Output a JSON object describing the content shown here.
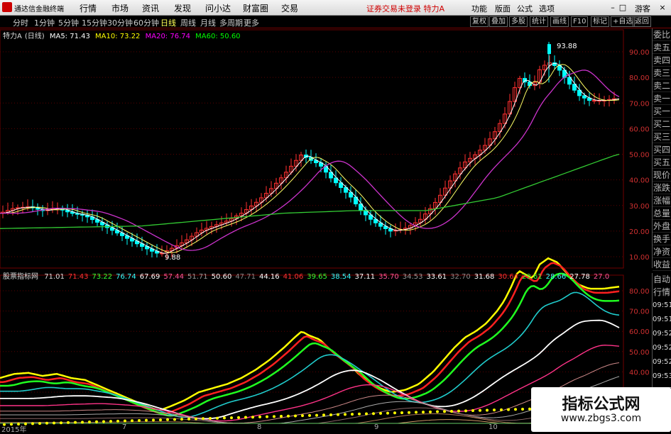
{
  "menubar": {
    "app_name": "通达信金融终端",
    "menus": [
      "行情",
      "市场",
      "资讯",
      "发现",
      "问小达",
      "财富圈",
      "交易"
    ],
    "notice": "证券交易未登录  特力A",
    "right_menus": [
      "功能",
      "版面",
      "公式",
      "选项"
    ],
    "user": "游客",
    "win_buttons": [
      "–",
      "□",
      "×"
    ]
  },
  "toolbar": {
    "periods": [
      "分时",
      "1分钟",
      "5分钟",
      "15分钟",
      "30分钟",
      "60分钟",
      "日线",
      "周线",
      "月线",
      "多周期",
      "更多"
    ],
    "active_period": "日线",
    "buttons": [
      "复权",
      "叠加",
      "多股",
      "统计",
      "画线",
      "F10",
      "标记",
      "+自选",
      "返回"
    ]
  },
  "main_chart": {
    "stock": "特力A",
    "period_tag": "(日线)",
    "ma": [
      {
        "label": "MA5: 71.43",
        "color": "#ffffff"
      },
      {
        "label": "MA10: 73.22",
        "color": "#ffff00"
      },
      {
        "label": "MA20: 76.74",
        "color": "#ff00ff"
      },
      {
        "label": "MA60: 50.60",
        "color": "#00ff00"
      }
    ],
    "high_label": "93.88",
    "low_label": "9.88",
    "y_ticks": [
      "90.00",
      "80.00",
      "70.00",
      "60.00",
      "50.00",
      "40.00",
      "30.00",
      "20.00",
      "10.00"
    ]
  },
  "sub_chart": {
    "name": "股票指标网",
    "values": [
      {
        "v": "71.01",
        "c": "#dddddd"
      },
      {
        "v": "71.43",
        "c": "#ff3333"
      },
      {
        "v": "73.22",
        "c": "#33ff33"
      },
      {
        "v": "76.74",
        "c": "#33ffff"
      },
      {
        "v": "67.69",
        "c": "#ffffff"
      },
      {
        "v": "57.44",
        "c": "#ff5599"
      },
      {
        "v": "51.71",
        "c": "#999999"
      },
      {
        "v": "50.60",
        "c": "#ffffff"
      },
      {
        "v": "47.71",
        "c": "#888888"
      },
      {
        "v": "44.16",
        "c": "#ffffff"
      },
      {
        "v": "41.06",
        "c": "#ff3333"
      },
      {
        "v": "39.65",
        "c": "#33ff33"
      },
      {
        "v": "38.54",
        "c": "#33ffff"
      },
      {
        "v": "37.11",
        "c": "#ffffff"
      },
      {
        "v": "35.70",
        "c": "#ff5599"
      },
      {
        "v": "34.53",
        "c": "#999999"
      },
      {
        "v": "33.61",
        "c": "#ffffff"
      },
      {
        "v": "32.70",
        "c": "#888888"
      },
      {
        "v": "31.68",
        "c": "#ffffff"
      },
      {
        "v": "30.64",
        "c": "#ff3333"
      },
      {
        "v": "29.61",
        "c": "#33ff33"
      },
      {
        "v": "28.66",
        "c": "#33ffff"
      },
      {
        "v": "27.78",
        "c": "#ffffff"
      },
      {
        "v": "27.0",
        "c": "#ff5599"
      }
    ],
    "y_ticks": [
      "80.00",
      "70.00",
      "60.00",
      "50.00",
      "40.00",
      "30.00"
    ]
  },
  "side_panel": [
    "委比",
    "卖五",
    "卖四",
    "卖三",
    "卖二",
    "卖一",
    "买一",
    "买二",
    "买三",
    "买四",
    "买五",
    "现价",
    "涨跌",
    "涨幅",
    "总量",
    "外盘",
    "换手",
    "净资",
    "收益"
  ],
  "sub_side": {
    "labels": [
      "自动",
      "行情"
    ],
    "times": [
      "09:51",
      "09:51",
      "09:52",
      "09:52",
      "09:52",
      "09:53",
      "09:53",
      "09:53"
    ]
  },
  "x_axis": [
    "2015年",
    "7",
    "8",
    "9",
    "10"
  ],
  "watermark": {
    "title": "指标公式网",
    "url": "www.zbgs3.com"
  },
  "colors": {
    "up": "#ff3030",
    "down": "#00ffff",
    "grid": "#800000",
    "axis": "#c00000"
  }
}
